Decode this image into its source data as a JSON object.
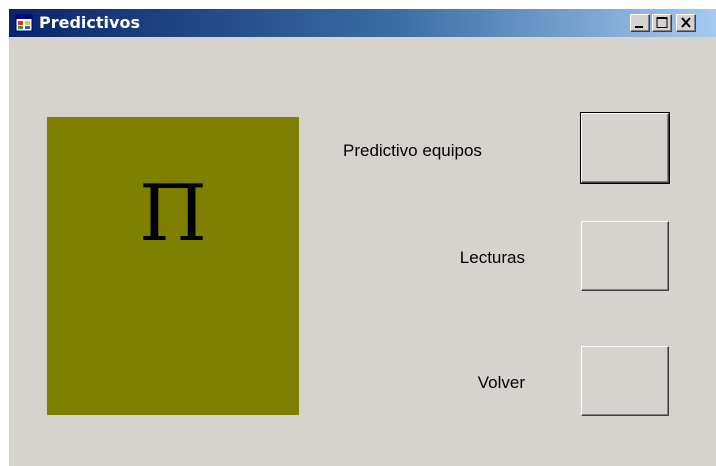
{
  "window": {
    "title": "Predictivos",
    "icon": "app-window-icon",
    "controls": {
      "minimize_icon": "minimize-icon",
      "maximize_icon": "maximize-icon",
      "close_icon": "close-icon"
    }
  },
  "logo": {
    "glyph": "Π",
    "background_color": "#808000"
  },
  "actions": [
    {
      "label": "Predictivo equipos"
    },
    {
      "label": "Lecturas"
    },
    {
      "label": "Volver"
    }
  ],
  "colors": {
    "window_background": "#d6d3ce",
    "titlebar_start": "#0a246a",
    "titlebar_end": "#a6caf0"
  }
}
